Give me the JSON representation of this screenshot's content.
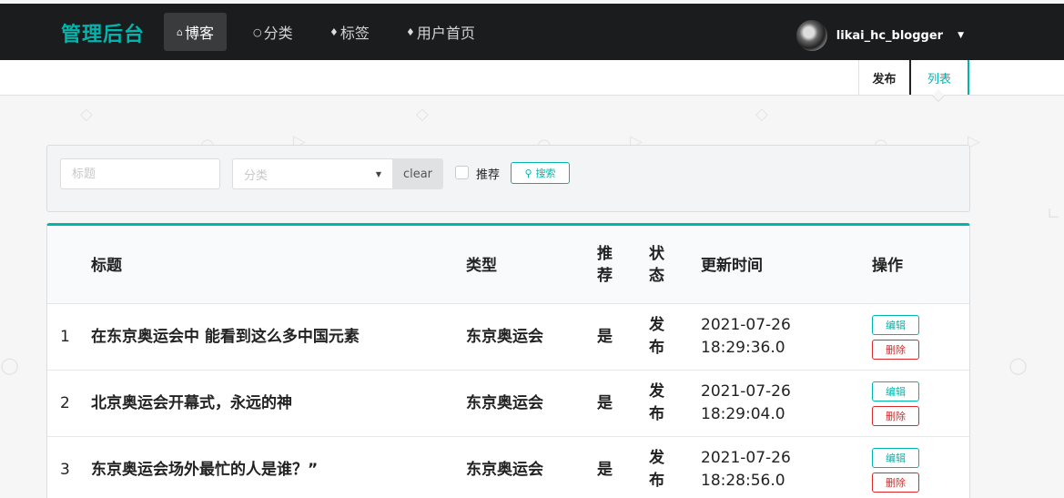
{
  "nav": {
    "brand": "管理后台",
    "items": [
      {
        "label": "博客",
        "icon": "home-icon"
      },
      {
        "label": "分类",
        "icon": "lightbulb-icon"
      },
      {
        "label": "标签",
        "icon": "tags-icon"
      },
      {
        "label": "用户首页",
        "icon": "tags-icon"
      }
    ],
    "user": "likai_hc_blogger"
  },
  "subnav": {
    "publish": "发布",
    "list": "列表"
  },
  "filter": {
    "title_placeholder": "标题",
    "category_placeholder": "分类",
    "clear_label": "clear",
    "recommend_label": "推荐",
    "search_label": "搜索"
  },
  "table": {
    "headers": {
      "title": "标题",
      "type": "类型",
      "recommend": "推荐",
      "status": "状态",
      "updated": "更新时间",
      "actions": "操作"
    },
    "rows": [
      {
        "num": "1",
        "title": "在东京奥运会中 能看到这么多中国元素",
        "type": "东京奥运会",
        "recommend": "是",
        "status": "发布",
        "date": "2021-07-26",
        "time": "18:29:36.0"
      },
      {
        "num": "2",
        "title": "北京奥运会开幕式，永远的神",
        "type": "东京奥运会",
        "recommend": "是",
        "status": "发布",
        "date": "2021-07-26",
        "time": "18:29:04.0"
      },
      {
        "num": "3",
        "title": "东京奥运会场外最忙的人是谁？”",
        "type": "东京奥运会",
        "recommend": "是",
        "status": "发布",
        "date": "2021-07-26",
        "time": "18:28:56.0"
      }
    ],
    "edit_label": "编辑",
    "delete_label": "删除"
  },
  "colors": {
    "accent": "#00b5ad",
    "danger": "#db2828",
    "nav_bg": "#1b1c1d"
  }
}
